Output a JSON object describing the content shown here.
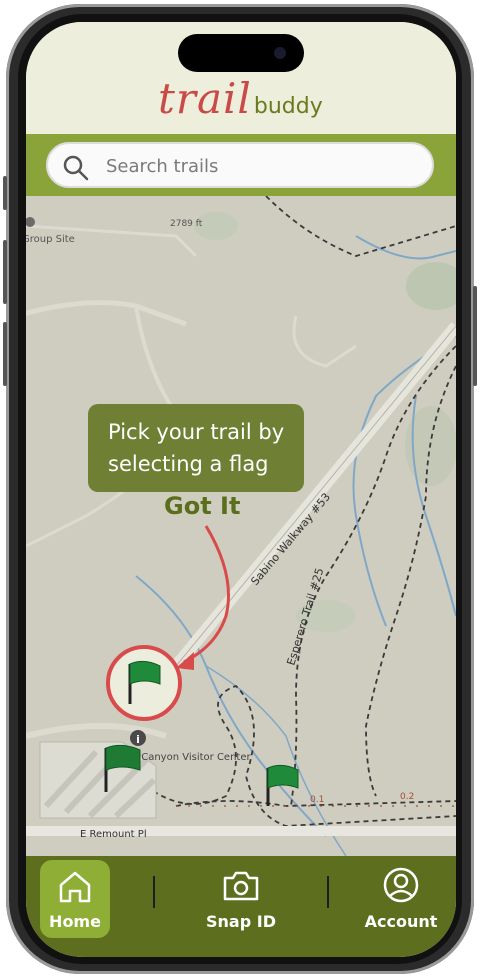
{
  "app": {
    "logo_trail": "trail",
    "logo_buddy": "buddy"
  },
  "search": {
    "placeholder": "Search trails",
    "icon": "search-icon"
  },
  "map": {
    "labels": {
      "group_site": "Group Site",
      "elevation": "2789 ft",
      "sabino_walkway": "Sabino Walkway #53",
      "esperero_trail": "Esperero Trail #25",
      "visitor_center": "Sabino Canyon Visitor Center",
      "remount": "E Remount Pl",
      "dist_1": "0.1",
      "dist_2": "0.2"
    },
    "tooltip": {
      "text": "Pick your trail by selecting a flag",
      "line1": "Pick your trail by",
      "line2": "selecting a flag",
      "button": "Got It"
    },
    "colors": {
      "flag": "#1f8a3a",
      "tooltip": "#6f7f34",
      "highlight": "#d94a4a"
    }
  },
  "nav": {
    "items": [
      {
        "label": "Home",
        "icon": "home-icon",
        "active": true
      },
      {
        "label": "Snap ID",
        "icon": "camera-icon",
        "active": false
      },
      {
        "label": "Account",
        "icon": "account-icon",
        "active": false
      }
    ]
  }
}
